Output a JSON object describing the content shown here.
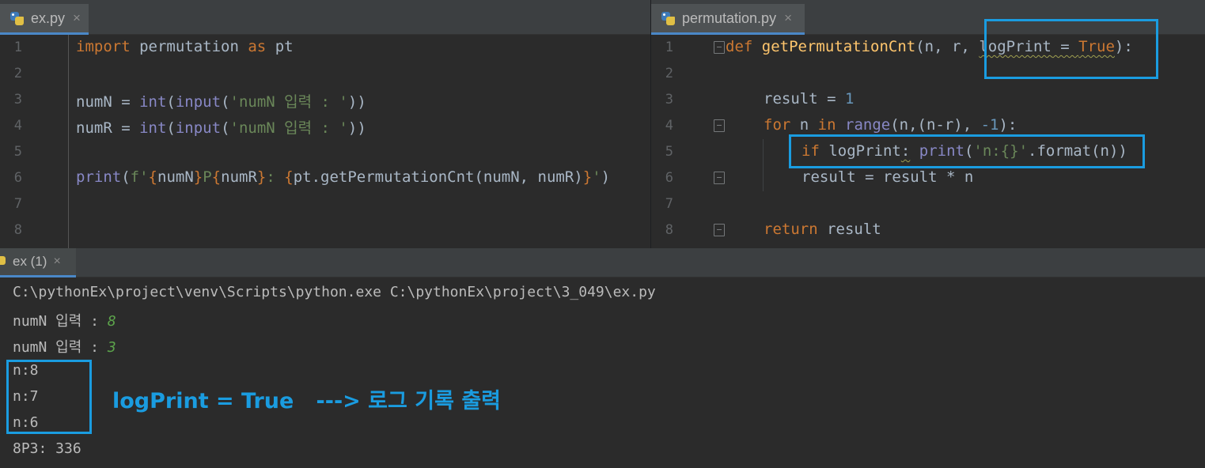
{
  "left_editor": {
    "tab": {
      "name": "ex.py",
      "close": "×",
      "icon": "python-file-icon"
    },
    "line_numbers": [
      "1",
      "2",
      "3",
      "4",
      "5",
      "6",
      "7",
      "8"
    ],
    "code": {
      "l1_import": "import",
      "l1_module": " permutation ",
      "l1_as": "as",
      "l1_alias": " pt",
      "l3_var": "numN = ",
      "l3_int": "int",
      "l3_open": "(",
      "l3_input": "input",
      "l3_open2": "(",
      "l3_str": "'numN 입력 : '",
      "l3_close": "))",
      "l4_var": "numR = ",
      "l4_int": "int",
      "l4_open": "(",
      "l4_input": "input",
      "l4_open2": "(",
      "l4_str": "'numN 입력 : '",
      "l4_close": "))",
      "l6_print": "print",
      "l6_open": "(",
      "l6_fprefix": "f'",
      "l6_b1": "{",
      "l6_v1": "numN",
      "l6_b2": "}",
      "l6_p": "P",
      "l6_b3": "{",
      "l6_v2": "numR",
      "l6_b4": "}",
      "l6_colon": ": ",
      "l6_b5": "{",
      "l6_call": "pt.getPermutationCnt(numN, numR)",
      "l6_b6": "}",
      "l6_end": "'",
      "l6_close": ")"
    }
  },
  "right_editor": {
    "tab": {
      "name": "permutation.py",
      "close": "×",
      "icon": "python-file-icon"
    },
    "line_numbers": [
      "1",
      "2",
      "3",
      "4",
      "5",
      "6",
      "7",
      "8"
    ],
    "code": {
      "l1_def": "def",
      "l1_fn": " getPermutationCnt",
      "l1_params": "(n, r, ",
      "l1_param": "logPrint",
      "l1_eq": " = ",
      "l1_true": "True",
      "l1_end": "):",
      "l3_result": "result = ",
      "l3_one": "1",
      "l4_for": "for",
      "l4_n": " n ",
      "l4_in": "in",
      "l4_sp": " ",
      "l4_range": "range",
      "l4_args": "(n,(n-r), ",
      "l4_neg": "-1",
      "l4_end": "):",
      "l5_if": "if",
      "l5_cond": " logPrint",
      "l5_colon": ":",
      "l5_sp": " ",
      "l5_print": "print",
      "l5_open": "(",
      "l5_str": "'n:{}'",
      "l5_rest": ".format(n))",
      "l6_stmt": "result = result * n",
      "l8_return": "return",
      "l8_val": " result"
    }
  },
  "run_panel": {
    "tab": {
      "label": "ex (1)",
      "close": "×"
    },
    "output": {
      "command": "C:\\pythonEx\\project\\venv\\Scripts\\python.exe C:\\pythonEx\\project\\3_049\\ex.py",
      "prompt1": "numN 입력 : ",
      "input1": "8",
      "prompt2": "numN 입력 : ",
      "input2": "3",
      "log_lines": [
        "n:8",
        "n:7",
        "n:6"
      ],
      "result": "8P3: 336"
    },
    "annotation": "logPrint = True   ---> 로그 기록 출력"
  },
  "colors": {
    "highlight": "#1a9ce0",
    "background": "#2b2b2b",
    "keyword": "#cc7832",
    "string": "#6a8759",
    "function": "#ffc66d",
    "builtin": "#8888c6",
    "number": "#6897bb",
    "user_input": "#5ca34b"
  }
}
